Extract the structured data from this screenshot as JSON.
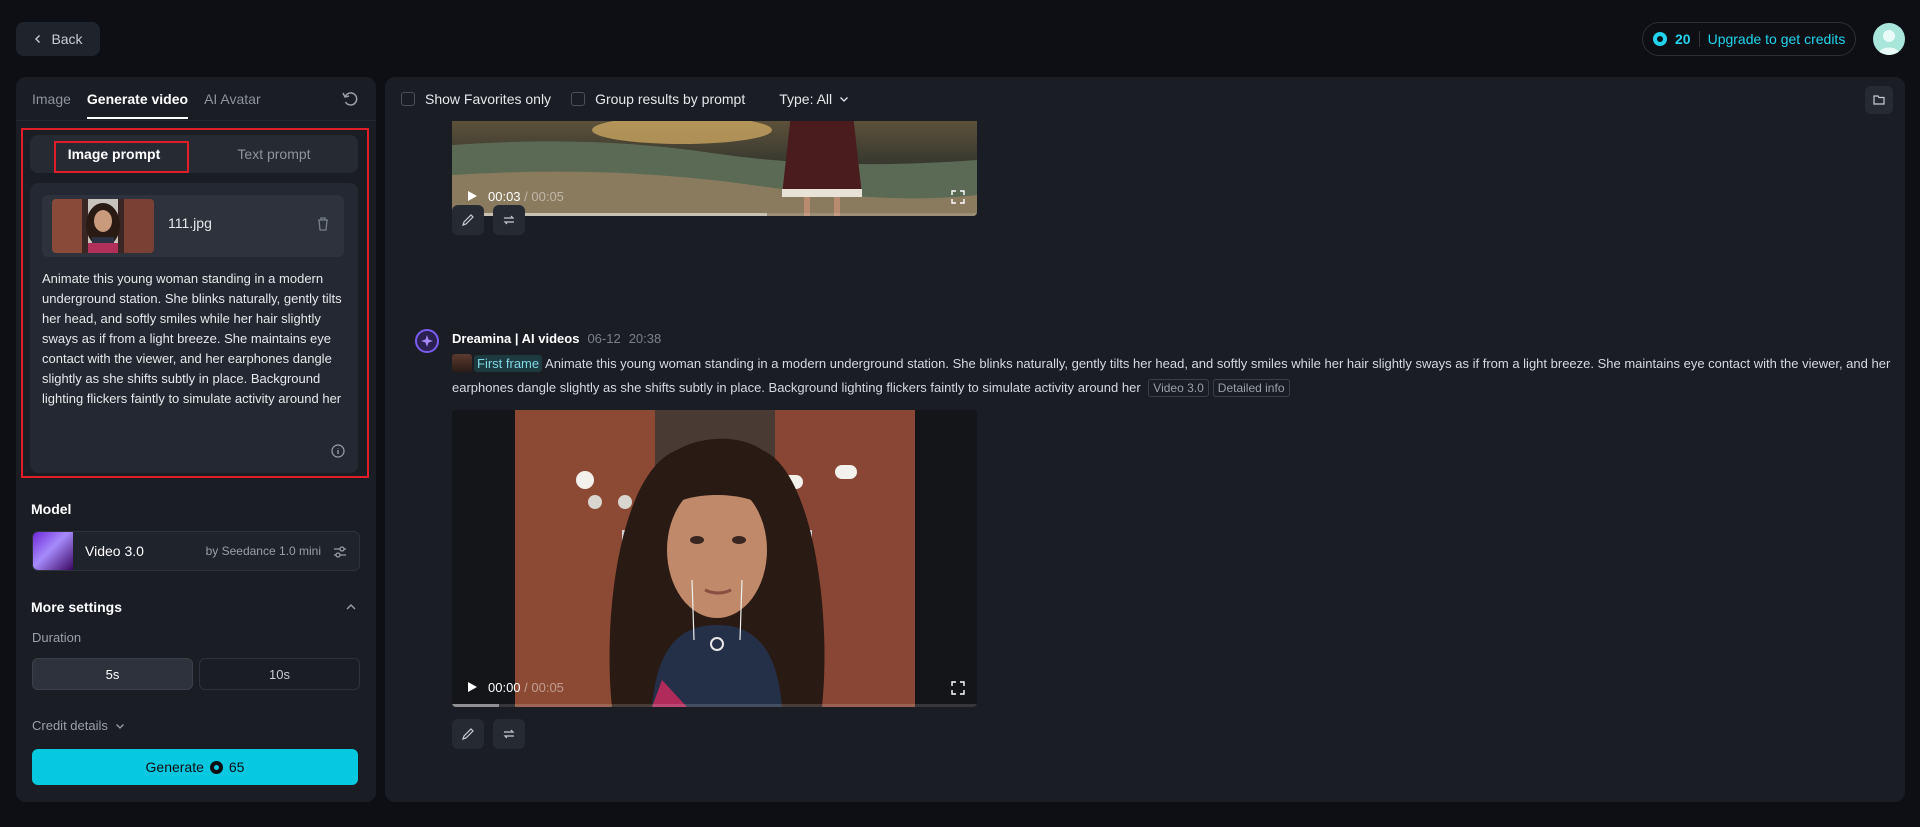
{
  "topbar": {
    "back_label": "Back",
    "credits_count": "20",
    "upgrade_label": "Upgrade to get credits"
  },
  "left": {
    "tabs": [
      "Image",
      "Generate video",
      "AI Avatar"
    ],
    "prompt_tabs": [
      "Image prompt",
      "Text prompt"
    ],
    "file_name": "111.jpg",
    "prompt_text": "Animate this young woman standing in a modern underground station. She blinks naturally, gently tilts her head, and softly smiles while her hair slightly sways as if from a light breeze. She maintains eye contact with the viewer, and her earphones dangle slightly as she shifts subtly in place. Background lighting flickers faintly to simulate activity around her",
    "model_label": "Model",
    "model_name": "Video 3.0",
    "model_by": "by Seedance 1.0 mini",
    "more_settings": "More settings",
    "duration_label": "Duration",
    "durations": [
      "5s",
      "10s"
    ],
    "credit_details": "Credit details",
    "generate_label": "Generate",
    "generate_cost": "65"
  },
  "right": {
    "show_favorites": "Show Favorites only",
    "group_results": "Group results by prompt",
    "type_label": "Type: All",
    "video1": {
      "current": "00:03",
      "duration": " / 00:05",
      "progress": 0.6
    },
    "message": {
      "author": "Dreamina | AI videos",
      "date": "06-12",
      "time": "20:38",
      "first_frame": "First frame",
      "prompt": "Animate this young woman standing in a modern underground station. She blinks naturally, gently tilts her head, and softly smiles while her hair slightly sways as if from a light breeze. She maintains eye contact with the viewer, and her earphones dangle slightly as she shifts subtly in place. Background lighting flickers faintly to simulate activity around her",
      "tags": [
        "Video 3.0",
        "Detailed info"
      ]
    },
    "video2": {
      "current": "00:00",
      "duration": " / 00:05",
      "progress": 0.09
    }
  },
  "colors": {
    "accent": "#06c8e0",
    "highlight_border": "#e11d2a",
    "panel": "#1a1d24"
  },
  "icons": [
    "chevron-left-icon",
    "coin-icon",
    "reset-icon",
    "trash-icon",
    "info-icon",
    "tune-icon",
    "chevron-up-icon",
    "chevron-down-icon",
    "folder-icon",
    "play-icon",
    "fullscreen-icon",
    "edit-icon",
    "regenerate-icon",
    "dreamina-logo-icon"
  ]
}
